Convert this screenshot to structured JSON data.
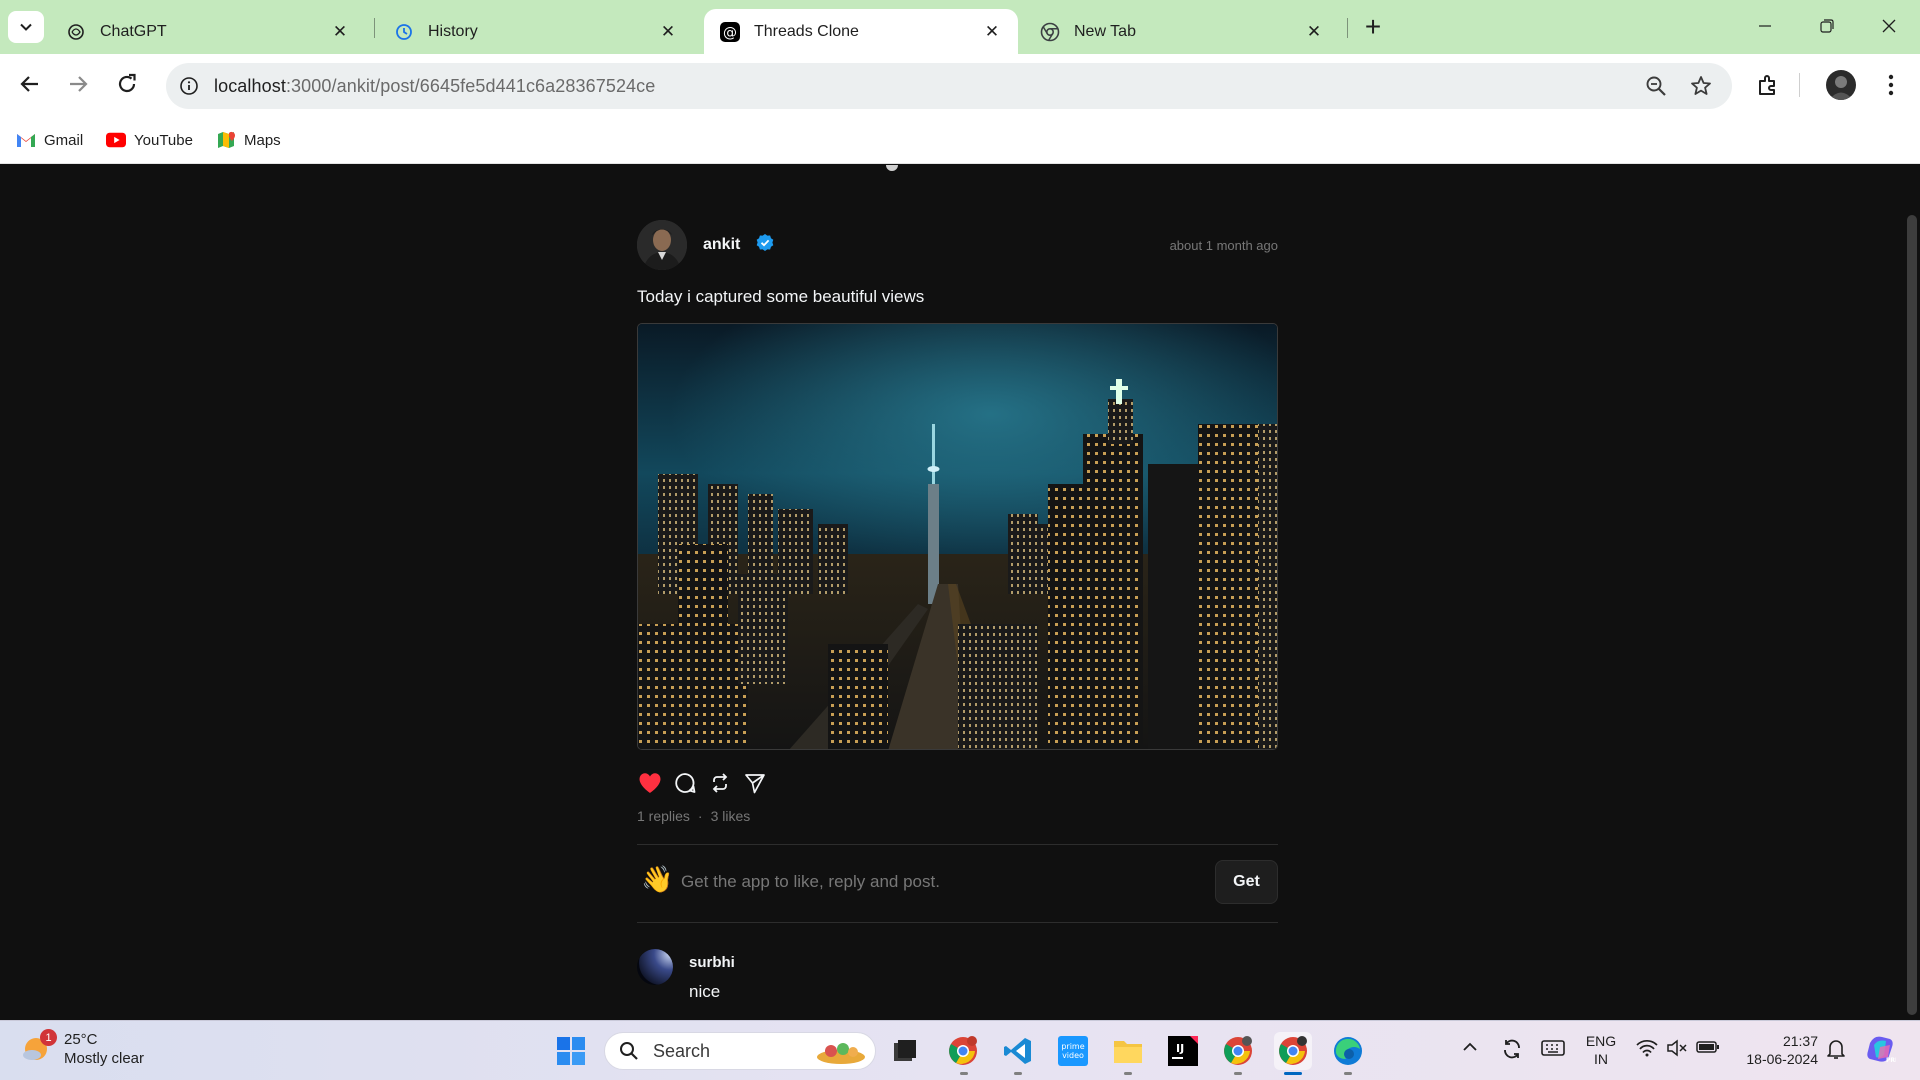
{
  "browser": {
    "tabs": [
      {
        "title": "ChatGPT",
        "icon": "chatgpt-icon",
        "active": false
      },
      {
        "title": "History",
        "icon": "history-icon",
        "active": false
      },
      {
        "title": "Threads Clone",
        "icon": "threads-icon",
        "active": true
      },
      {
        "title": "New Tab",
        "icon": "chrome-icon",
        "active": false
      }
    ],
    "url_host": "localhost",
    "url_rest": ":3000/ankit/post/6645fe5d441c6a28367524ce",
    "bookmarks": [
      {
        "label": "Gmail",
        "icon": "gmail-icon"
      },
      {
        "label": "YouTube",
        "icon": "youtube-icon"
      },
      {
        "label": "Maps",
        "icon": "maps-icon"
      }
    ]
  },
  "post": {
    "username": "ankit",
    "verified": true,
    "time": "about 1 month ago",
    "text": "Today i captured some beautiful views",
    "liked": true,
    "replies_label": "1 replies",
    "separator": "·",
    "likes_label": "3 likes"
  },
  "getapp": {
    "emoji": "👋",
    "text": "Get the app to like, reply and post.",
    "button": "Get"
  },
  "reply": {
    "username": "surbhi",
    "text": "nice"
  },
  "taskbar": {
    "weather_badge": "1",
    "temperature": "25°C",
    "condition": "Mostly clear",
    "search_placeholder": "Search",
    "lang_line1": "ENG",
    "lang_line2": "IN",
    "time": "21:37",
    "date": "18-06-2024"
  },
  "colors": {
    "page_bg": "#101010",
    "like_red": "#ff3040",
    "verified_blue": "#1d9bf0",
    "tab_strip": "#c4e9bd"
  }
}
